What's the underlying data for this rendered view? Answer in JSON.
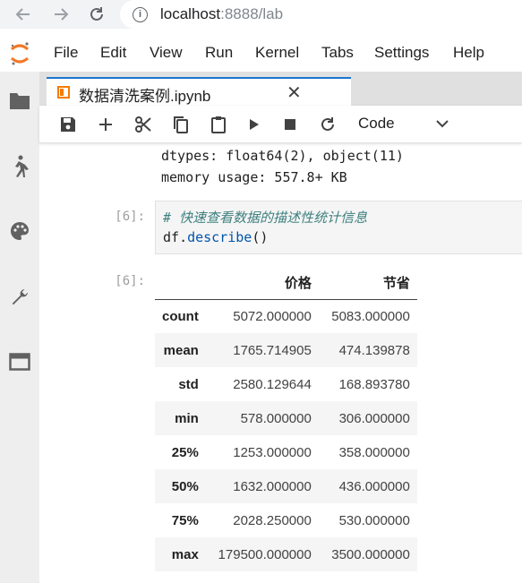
{
  "browser": {
    "url_host": "localhost",
    "url_rest": ":8888/lab",
    "info_icon": "i"
  },
  "menu": [
    "File",
    "Edit",
    "View",
    "Run",
    "Kernel",
    "Tabs",
    "Settings",
    "Help"
  ],
  "tab": {
    "title": "数据清洗案例.ipynb",
    "close": "✕"
  },
  "toolbar": {
    "cell_type": "Code"
  },
  "notebook": {
    "prev_output_lines": [
      "dtypes: float64(2), object(11)",
      "memory usage: 557.8+ KB"
    ],
    "code_cell": {
      "prompt": "[6]:",
      "comment": "# 快速查看数据的描述性统计信息",
      "code_var": "df",
      "code_dot": ".",
      "code_method": "describe",
      "code_parens": "()"
    },
    "output_cell": {
      "prompt": "[6]:",
      "table": {
        "columns": [
          "",
          "价格",
          "节省"
        ],
        "rows": [
          {
            "index": "count",
            "values": [
              "5072.000000",
              "5083.000000"
            ]
          },
          {
            "index": "mean",
            "values": [
              "1765.714905",
              "474.139878"
            ]
          },
          {
            "index": "std",
            "values": [
              "2580.129644",
              "168.893780"
            ]
          },
          {
            "index": "min",
            "values": [
              "578.000000",
              "306.000000"
            ]
          },
          {
            "index": "25%",
            "values": [
              "1253.000000",
              "358.000000"
            ]
          },
          {
            "index": "50%",
            "values": [
              "1632.000000",
              "436.000000"
            ]
          },
          {
            "index": "75%",
            "values": [
              "2028.250000",
              "530.000000"
            ]
          },
          {
            "index": "max",
            "values": [
              "179500.000000",
              "3500.000000"
            ]
          }
        ]
      }
    }
  },
  "colors": {
    "accent": "#1976d2",
    "notebook_icon": "#f57c00",
    "jupyter_logo": "#f37726"
  }
}
